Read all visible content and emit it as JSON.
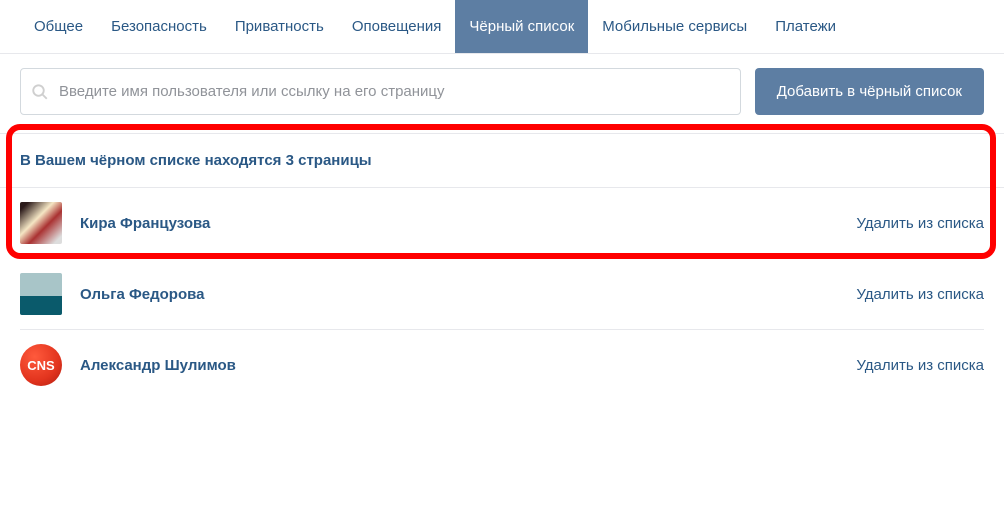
{
  "tabs": [
    {
      "label": "Общее",
      "active": false
    },
    {
      "label": "Безопасность",
      "active": false
    },
    {
      "label": "Приватность",
      "active": false
    },
    {
      "label": "Оповещения",
      "active": false
    },
    {
      "label": "Чёрный список",
      "active": true
    },
    {
      "label": "Мобильные сервисы",
      "active": false
    },
    {
      "label": "Платежи",
      "active": false
    }
  ],
  "search": {
    "placeholder": "Введите имя пользователя или ссылку на его страницу",
    "value": ""
  },
  "add_button": "Добавить в чёрный список",
  "list_title": "В Вашем чёрном списке находятся 3 страницы",
  "remove_label": "Удалить из списка",
  "users": [
    {
      "name": "Кира Французова",
      "avatar_class": "av1",
      "avatar_shape": "square",
      "avatar_text": ""
    },
    {
      "name": "Ольга Федорова",
      "avatar_class": "av2",
      "avatar_shape": "square",
      "avatar_text": ""
    },
    {
      "name": "Александр Шулимов",
      "avatar_class": "av3",
      "avatar_shape": "circle",
      "avatar_text": "CNS"
    }
  ]
}
